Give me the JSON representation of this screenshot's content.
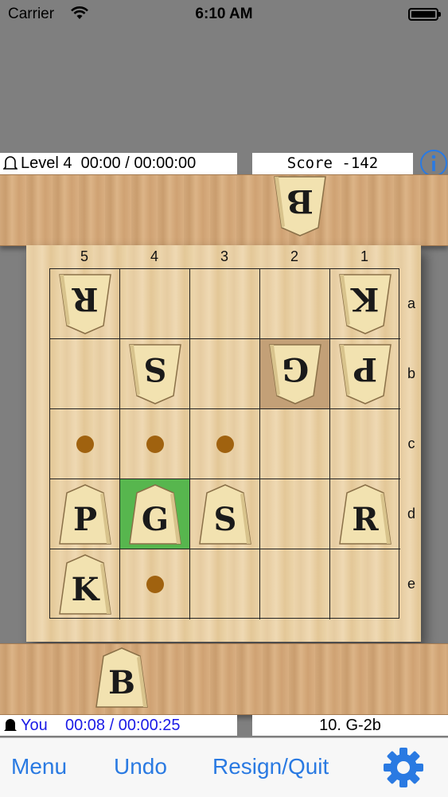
{
  "status": {
    "carrier": "Carrier",
    "time": "6:10 AM"
  },
  "opponent": {
    "level": "Level 4",
    "clock": "00:00 / 00:00:00",
    "score": "Score -142",
    "hand_piece": "B"
  },
  "board": {
    "files": [
      "5",
      "4",
      "3",
      "2",
      "1"
    ],
    "ranks": [
      "a",
      "b",
      "c",
      "d",
      "e"
    ],
    "pieces": [
      {
        "label": "R",
        "owner": "gote",
        "file": "5",
        "rank": "a"
      },
      {
        "label": "K",
        "owner": "gote",
        "file": "1",
        "rank": "a"
      },
      {
        "label": "S",
        "owner": "gote",
        "file": "4",
        "rank": "b"
      },
      {
        "label": "G",
        "owner": "gote",
        "file": "2",
        "rank": "b"
      },
      {
        "label": "P",
        "owner": "gote",
        "file": "1",
        "rank": "b"
      },
      {
        "label": "P",
        "owner": "sente",
        "file": "5",
        "rank": "d"
      },
      {
        "label": "G",
        "owner": "sente",
        "file": "4",
        "rank": "d"
      },
      {
        "label": "S",
        "owner": "sente",
        "file": "3",
        "rank": "d"
      },
      {
        "label": "R",
        "owner": "sente",
        "file": "1",
        "rank": "d"
      },
      {
        "label": "K",
        "owner": "sente",
        "file": "5",
        "rank": "e"
      }
    ],
    "move_hints": [
      "5c",
      "4c",
      "3c",
      "4e"
    ],
    "selected_square": "4d",
    "last_move_square": "2b"
  },
  "player": {
    "name": "You",
    "clock": "00:08 / 00:00:25",
    "hand_piece": "B"
  },
  "last_move": "10. G-2b",
  "toolbar": {
    "menu": "Menu",
    "undo": "Undo",
    "resign": "Resign/Quit"
  },
  "colors": {
    "selected": "#57b64e",
    "last_move": "#c3a077",
    "hint_dot": "#a0620f",
    "accent": "#2a7ae2"
  }
}
